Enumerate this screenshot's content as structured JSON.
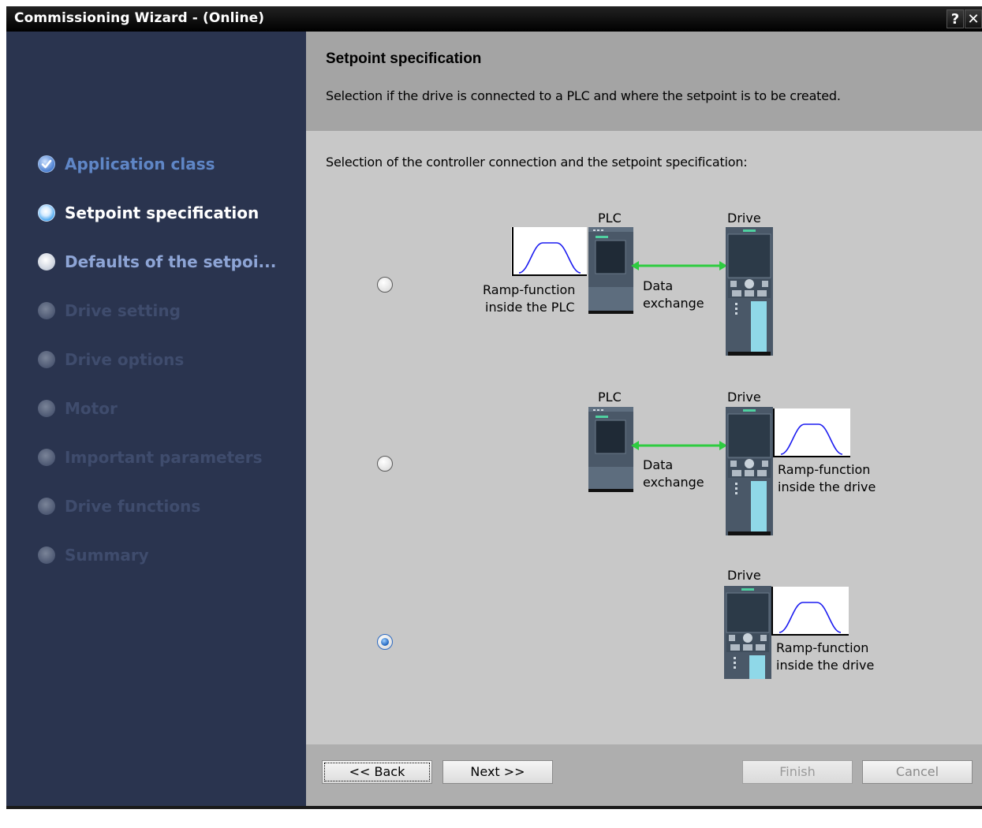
{
  "window": {
    "title": "Commissioning Wizard - (Online)",
    "help_label": "?",
    "close_label": "✕"
  },
  "sidebar": {
    "steps": [
      {
        "label": "Application class",
        "state": "completed"
      },
      {
        "label": "Setpoint specification",
        "state": "active"
      },
      {
        "label": "Defaults of the setpoi...",
        "state": "available"
      },
      {
        "label": "Drive setting",
        "state": "disabled"
      },
      {
        "label": "Drive options",
        "state": "disabled"
      },
      {
        "label": "Motor",
        "state": "disabled"
      },
      {
        "label": "Important parameters",
        "state": "disabled"
      },
      {
        "label": "Drive functions",
        "state": "disabled"
      },
      {
        "label": "Summary",
        "state": "disabled"
      }
    ]
  },
  "header": {
    "title": "Setpoint specification",
    "subtitle": "Selection if the drive is connected to a PLC and where the setpoint is to be created."
  },
  "main": {
    "instruction": "Selection of the controller connection and the setpoint specification:",
    "options": [
      {
        "selected": false,
        "plc_label": "PLC",
        "drive_label": "Drive",
        "ramp_line1": "Ramp-function",
        "ramp_line2": "inside the PLC",
        "exchange_line1": "Data",
        "exchange_line2": "exchange"
      },
      {
        "selected": false,
        "plc_label": "PLC",
        "drive_label": "Drive",
        "ramp_line1": "Ramp-function",
        "ramp_line2": "inside the drive",
        "exchange_line1": "Data",
        "exchange_line2": "exchange"
      },
      {
        "selected": true,
        "drive_label": "Drive",
        "ramp_line1": "Ramp-function",
        "ramp_line2": "inside the drive"
      }
    ]
  },
  "buttons": {
    "back": "<< Back",
    "next": "Next >>",
    "finish": "Finish",
    "cancel": "Cancel"
  },
  "colors": {
    "sidebar_bg": "#2a344f",
    "content_bg": "#c8c8c8",
    "header_bg": "#a4a4a4",
    "exchange_arrow": "#2ecc40",
    "ramp_curve": "#1c1cf0",
    "device_body": "#4a5868"
  }
}
